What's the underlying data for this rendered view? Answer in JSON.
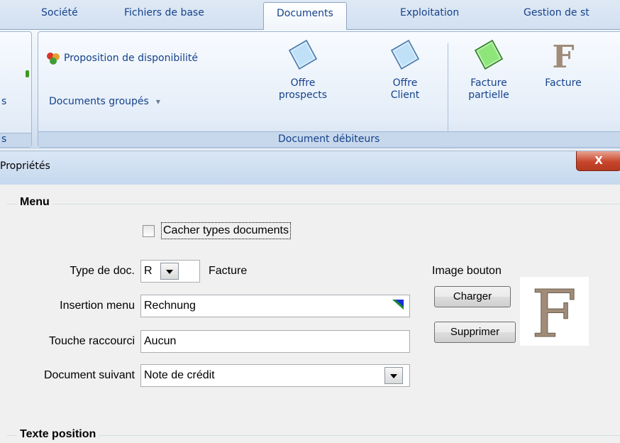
{
  "ribbon_tabs": [
    {
      "label": "Société"
    },
    {
      "label": "Fichiers de base"
    },
    {
      "label": "Documents"
    },
    {
      "label": "Exploitation"
    },
    {
      "label": "Gestion de st"
    }
  ],
  "ribbon": {
    "left_group_fragment_label": "s",
    "left_group_fragment_caption": "s",
    "proposition_label": "Proposition de disponibilité",
    "documents_groupes_label": "Documents groupés",
    "dropdown_glyph": "▾",
    "big_buttons": [
      {
        "line1": "Offre",
        "line2": "prospects"
      },
      {
        "line1": "Offre",
        "line2": "Client"
      },
      {
        "line1": "Facture",
        "line2": "partielle"
      },
      {
        "line1": "Facture",
        "line2": ""
      }
    ],
    "group_caption": "Document débiteurs"
  },
  "dialog": {
    "title": "Propriétés",
    "close_glyph": "X",
    "menu_section": {
      "legend": "Menu",
      "hide_types_label": "Cacher types documents",
      "hide_types_checked": false,
      "type_label": "Type de doc.",
      "type_value": "R",
      "type_desc": "Facture",
      "insertion_label": "Insertion menu",
      "insertion_value": "Rechnung",
      "shortcut_label": "Touche raccourci",
      "shortcut_value": "Aucun",
      "next_doc_label": "Document suivant",
      "next_doc_value": "Note de crédit",
      "image_label": "Image bouton",
      "load_button": "Charger",
      "delete_button": "Supprimer",
      "preview_letter": "F"
    },
    "position_section": {
      "legend": "Texte position"
    }
  },
  "colors": {
    "ribbon_text": "#15428b",
    "close_button": "#c8462c",
    "offre_icon": "#bfe0f7",
    "facture_partielle_icon": "#8ee67a",
    "facture_letter": "#a08c78"
  },
  "icons": [
    "proposition-icon",
    "offre-prospects-icon",
    "offre-client-icon",
    "facture-partielle-icon",
    "facture-f-icon",
    "close-icon",
    "dropdown-arrow-icon"
  ]
}
